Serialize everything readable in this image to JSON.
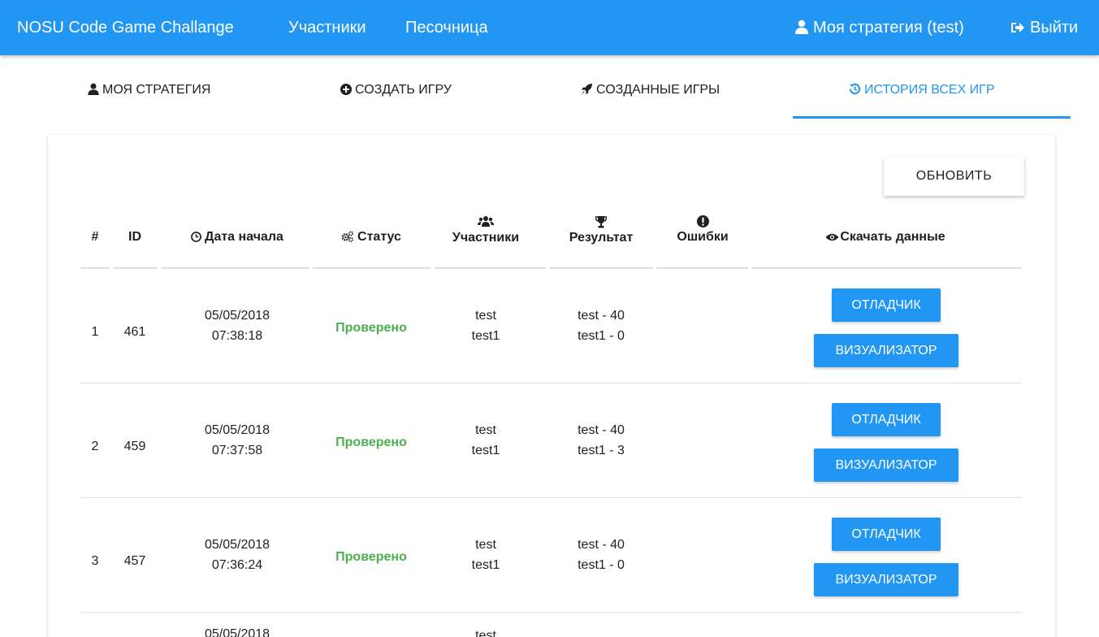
{
  "navbar": {
    "brand": "NOSU Code Game Challange",
    "participants": "Участники",
    "sandbox": "Песочница",
    "my_strategy": "Моя стратегия (test)",
    "logout": "Выйти"
  },
  "tabs": {
    "my_strategy": "МОЯ СТРАТЕГИЯ",
    "create_game": "СОЗДАТЬ ИГРУ",
    "created_games": "СОЗДАННЫЕ ИГРЫ",
    "history": "ИСТОРИЯ ВСЕХ ИГР"
  },
  "refresh_label": "ОБНОВИТЬ",
  "table": {
    "headers": {
      "num": "#",
      "id": "ID",
      "start_date": "Дата начала",
      "status": "Статус",
      "participants": "Участники",
      "result": "Результат",
      "errors": "Ошибки",
      "download": "Скачать данные"
    },
    "rows": [
      {
        "num": "1",
        "id": "461",
        "date": "05/05/2018",
        "time": "07:38:18",
        "status": "Проверено",
        "p1": "test",
        "p2": "test1",
        "r1": "test - 40",
        "r2": "test1 - 0",
        "debugger": "ОТЛАДЧИК",
        "visualizer": "ВИЗУАЛИЗАТОР"
      },
      {
        "num": "2",
        "id": "459",
        "date": "05/05/2018",
        "time": "07:37:58",
        "status": "Проверено",
        "p1": "test",
        "p2": "test1",
        "r1": "test - 40",
        "r2": "test1 - 3",
        "debugger": "ОТЛАДЧИК",
        "visualizer": "ВИЗУАЛИЗАТОР"
      },
      {
        "num": "3",
        "id": "457",
        "date": "05/05/2018",
        "time": "07:36:24",
        "status": "Проверено",
        "p1": "test",
        "p2": "test1",
        "r1": "test - 40",
        "r2": "test1 - 0",
        "debugger": "ОТЛАДЧИК",
        "visualizer": "ВИЗУАЛИЗАТОР"
      },
      {
        "date": "05/05/2018",
        "p1": "test"
      }
    ]
  },
  "colors": {
    "primary": "#2196f3",
    "success": "#4caf50"
  },
  "icons": [
    "user-icon",
    "logout-icon",
    "plus-circle-icon",
    "rocket-icon",
    "history-icon",
    "clock-icon",
    "cogs-icon",
    "users-icon",
    "trophy-icon",
    "exclamation-icon",
    "eye-icon"
  ]
}
